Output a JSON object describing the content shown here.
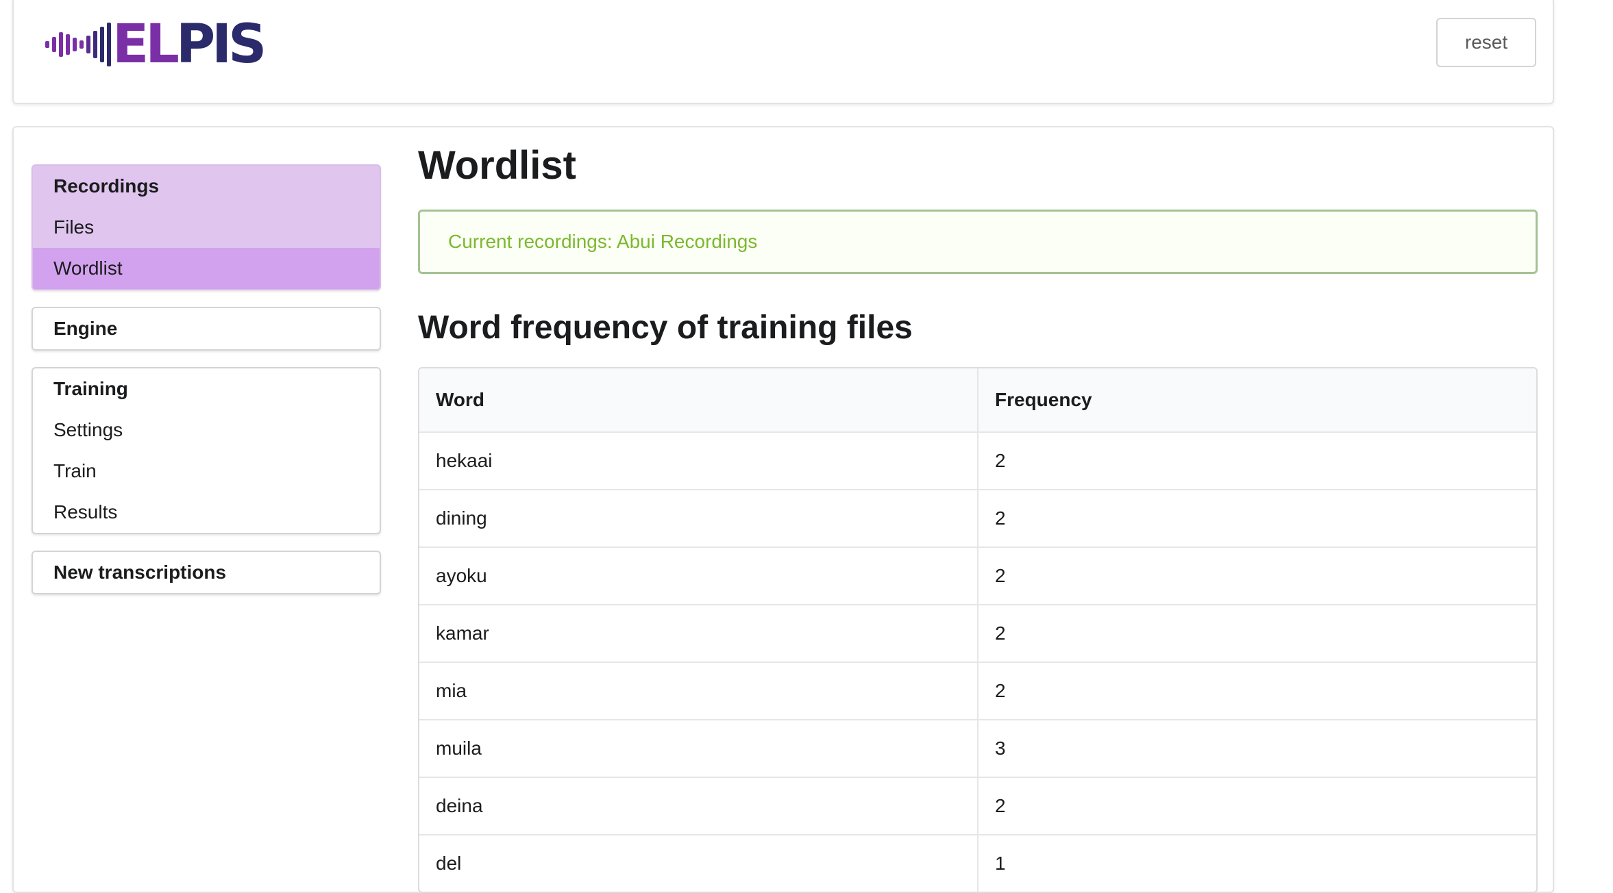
{
  "header": {
    "logo_text_el": "EL",
    "logo_text_pis": "PIS",
    "reset_label": "reset",
    "colors": {
      "logo_purple": "#7b2fa6",
      "logo_navy": "#2b2a6b"
    }
  },
  "sidebar": {
    "recordings": {
      "heading": "Recordings",
      "items": [
        {
          "label": "Files",
          "active": false
        },
        {
          "label": "Wordlist",
          "active": true
        }
      ]
    },
    "engine": {
      "heading": "Engine"
    },
    "training": {
      "heading": "Training",
      "items": [
        {
          "label": "Settings"
        },
        {
          "label": "Train"
        },
        {
          "label": "Results"
        }
      ]
    },
    "new_transcriptions": {
      "heading": "New transcriptions"
    }
  },
  "main": {
    "title": "Wordlist",
    "message": "Current recordings: Abui Recordings",
    "section_title": "Word frequency of training files",
    "table": {
      "columns": [
        "Word",
        "Frequency"
      ],
      "rows": [
        [
          "hekaai",
          "2"
        ],
        [
          "dining",
          "2"
        ],
        [
          "ayoku",
          "2"
        ],
        [
          "kamar",
          "2"
        ],
        [
          "mia",
          "2"
        ],
        [
          "muila",
          "3"
        ],
        [
          "deina",
          "2"
        ],
        [
          "del",
          "1"
        ]
      ]
    }
  },
  "colors": {
    "nav_group_bg": "#e0c6ef",
    "nav_active_bg": "#d3a2ef",
    "message_text": "#7cb82f",
    "message_border": "#a3c293"
  }
}
